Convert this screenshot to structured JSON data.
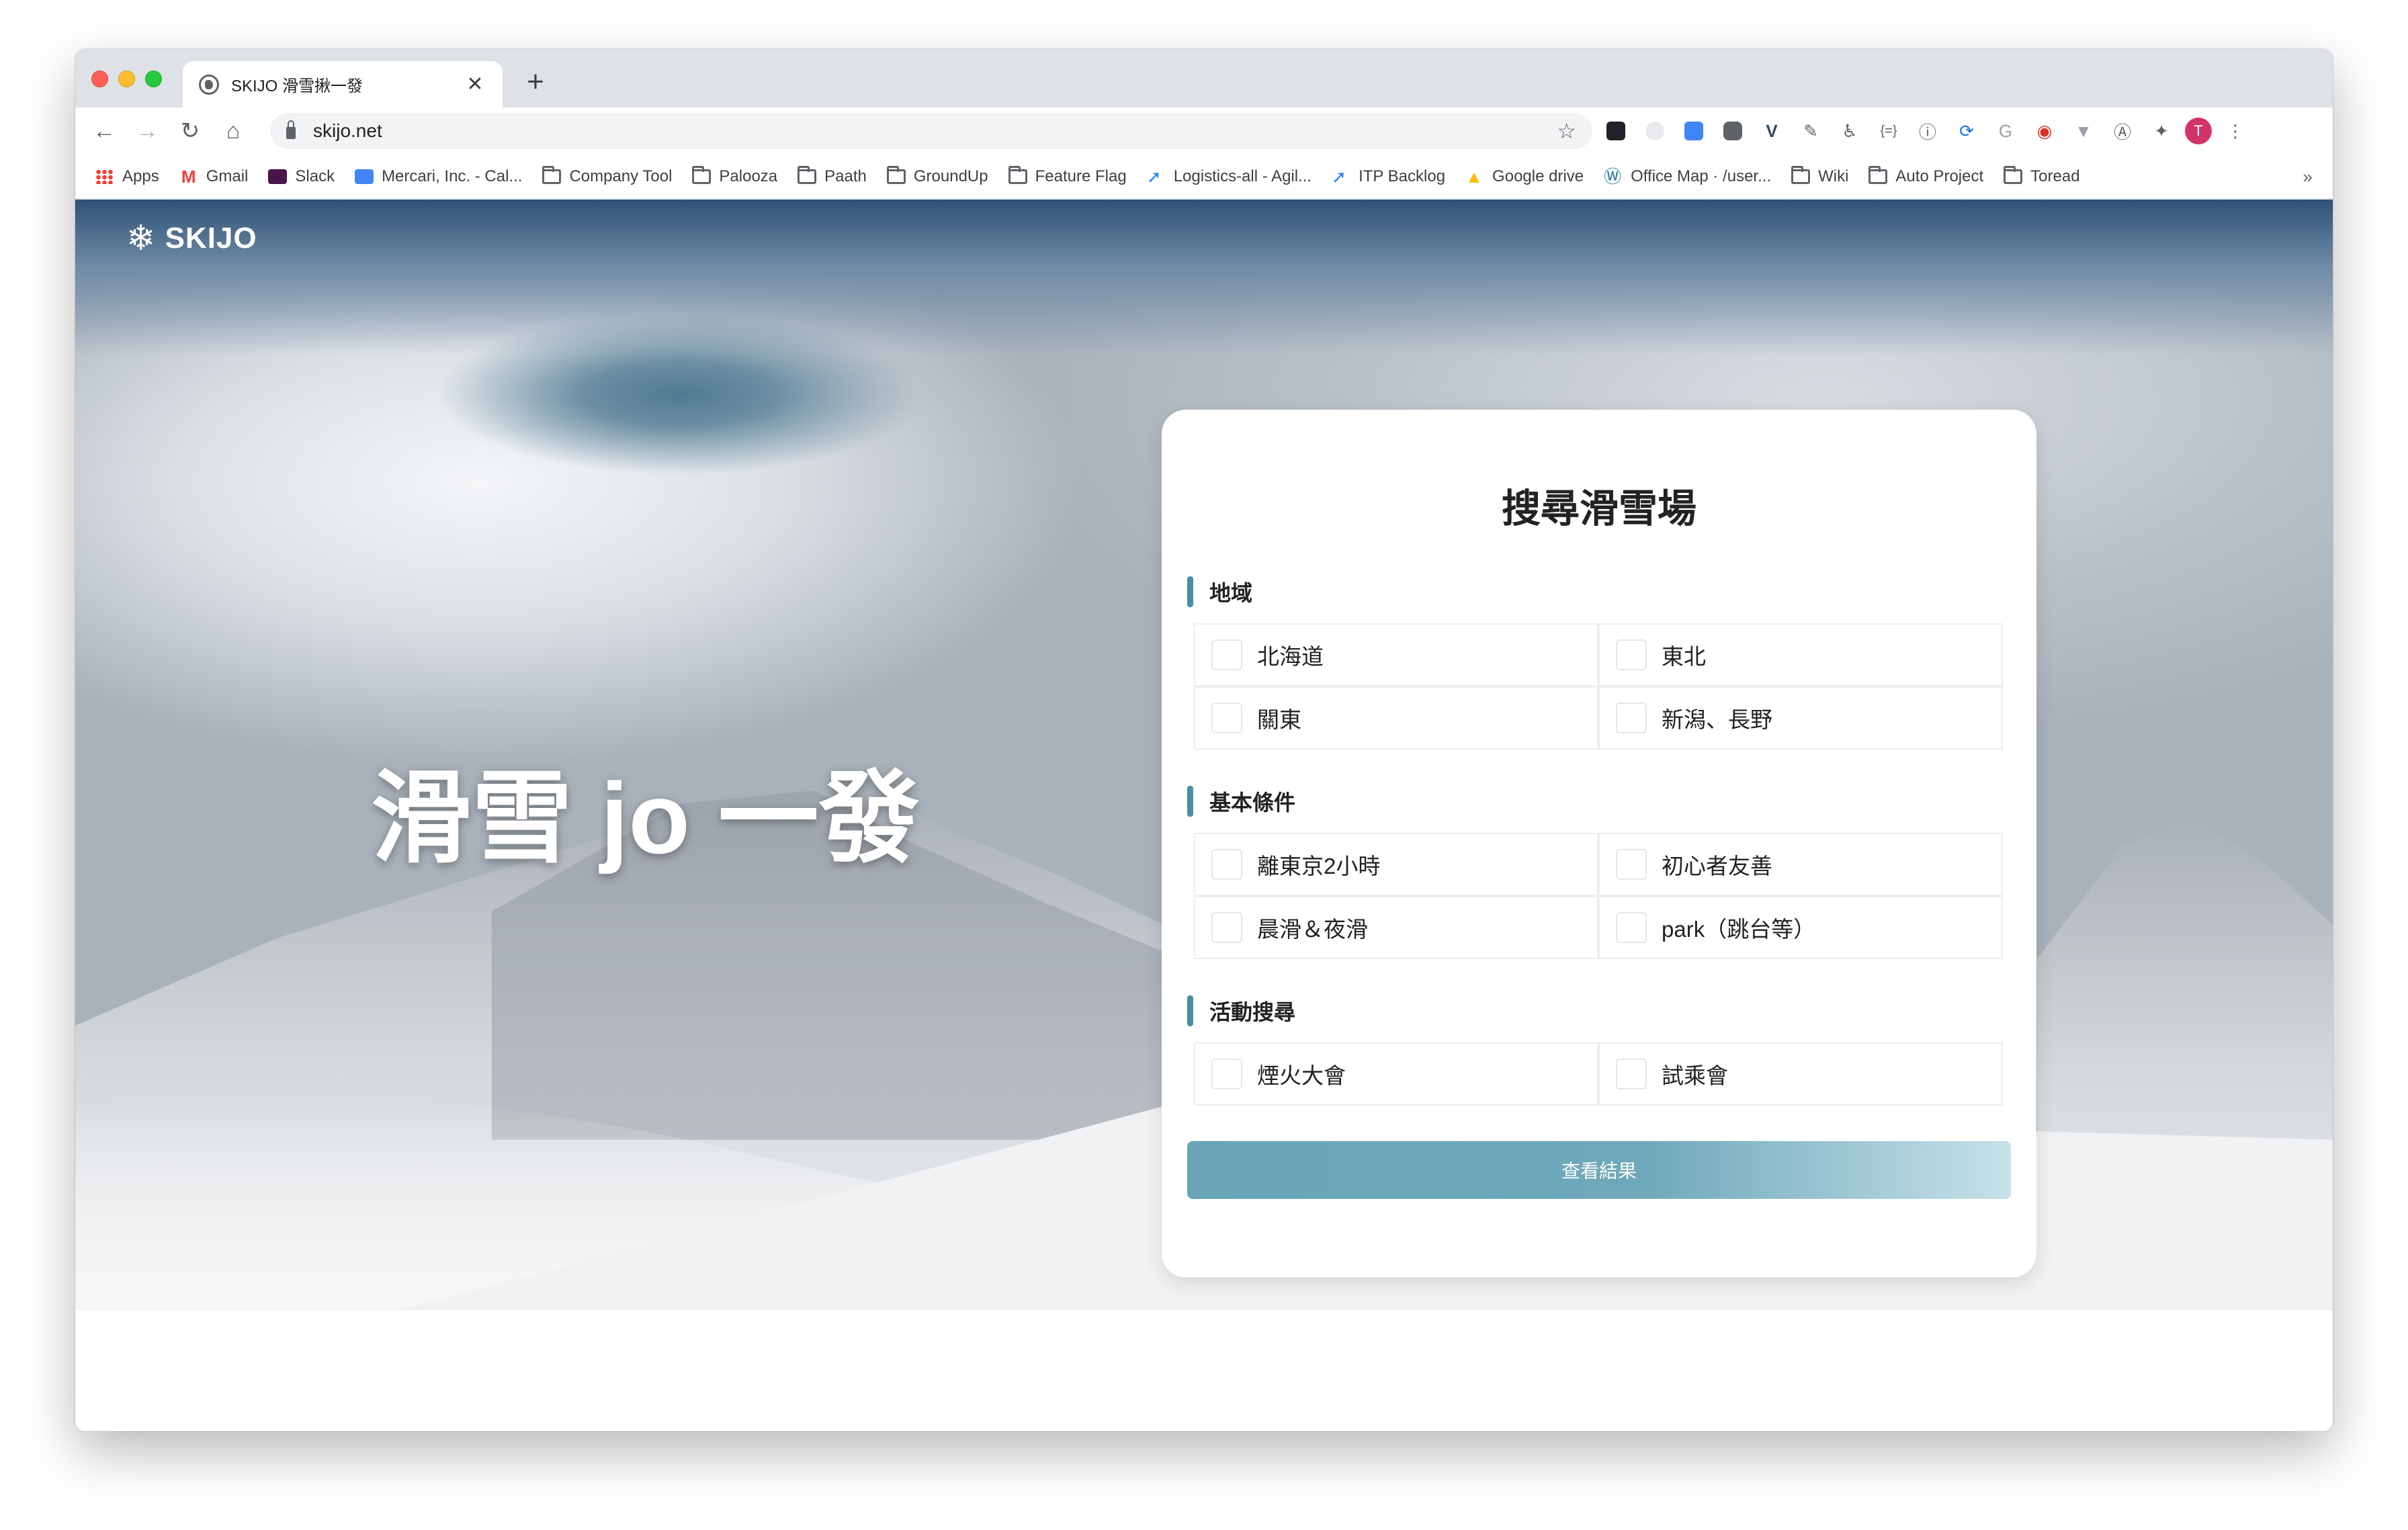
{
  "browser": {
    "tab_title": "SKIJO 滑雪揪一發",
    "tab_close": "✕",
    "new_tab": "+",
    "url": "skijo.net",
    "profile_initial": "T",
    "nav": {
      "back": "←",
      "forward": "→",
      "reload": "↻",
      "home": "⌂"
    },
    "extensions": [
      "react-devtools-icon",
      "timer-icon",
      "translate-icon",
      "chat-icon",
      "vue-devtools-icon",
      "color-picker-icon",
      "accessibility-icon",
      "json-icon",
      "onepassword-icon",
      "refresh-icon",
      "google-icon",
      "scroll-icon",
      "vuetify-icon",
      "a11y-icon",
      "puzzle-icon"
    ],
    "bookmarks": [
      {
        "label": "Apps",
        "icon": "apps-grid-icon"
      },
      {
        "label": "Gmail",
        "icon": "gmail-icon"
      },
      {
        "label": "Slack",
        "icon": "slack-icon"
      },
      {
        "label": "Mercari, Inc. - Cal...",
        "icon": "calendar-icon"
      },
      {
        "label": "Company Tool",
        "icon": "folder-icon"
      },
      {
        "label": "Palooza",
        "icon": "folder-icon"
      },
      {
        "label": "Paath",
        "icon": "folder-icon"
      },
      {
        "label": "GroundUp",
        "icon": "folder-icon"
      },
      {
        "label": "Feature Flag",
        "icon": "folder-icon"
      },
      {
        "label": "Logistics-all - Agil...",
        "icon": "jira-icon"
      },
      {
        "label": "ITP Backlog",
        "icon": "jira-icon"
      },
      {
        "label": "Google drive",
        "icon": "google-drive-icon"
      },
      {
        "label": "Office Map · /user...",
        "icon": "wordpress-icon"
      },
      {
        "label": "Wiki",
        "icon": "folder-icon"
      },
      {
        "label": "Auto Project",
        "icon": "folder-icon"
      },
      {
        "label": "Toread",
        "icon": "folder-icon"
      }
    ],
    "bookmarks_more": "»"
  },
  "site": {
    "logo_icon": "❄",
    "logo_text": "SKIJO",
    "hero_title": "滑雪 jo 一發"
  },
  "search": {
    "title": "搜尋滑雪場",
    "sections": [
      {
        "label": "地域",
        "options": [
          "北海道",
          "東北",
          "關東",
          "新潟、長野"
        ]
      },
      {
        "label": "基本條件",
        "options": [
          "離東京2小時",
          "初心者友善",
          "晨滑＆夜滑",
          "park（跳台等）"
        ]
      },
      {
        "label": "活動搜尋",
        "options": [
          "煙火大會",
          "試乘會"
        ]
      }
    ],
    "submit_label": "查看結果"
  },
  "colors": {
    "accent": "#4a8ea4",
    "button_start": "#6aa5b8",
    "button_end": "#c6e1e9",
    "profile": "#d33467"
  }
}
